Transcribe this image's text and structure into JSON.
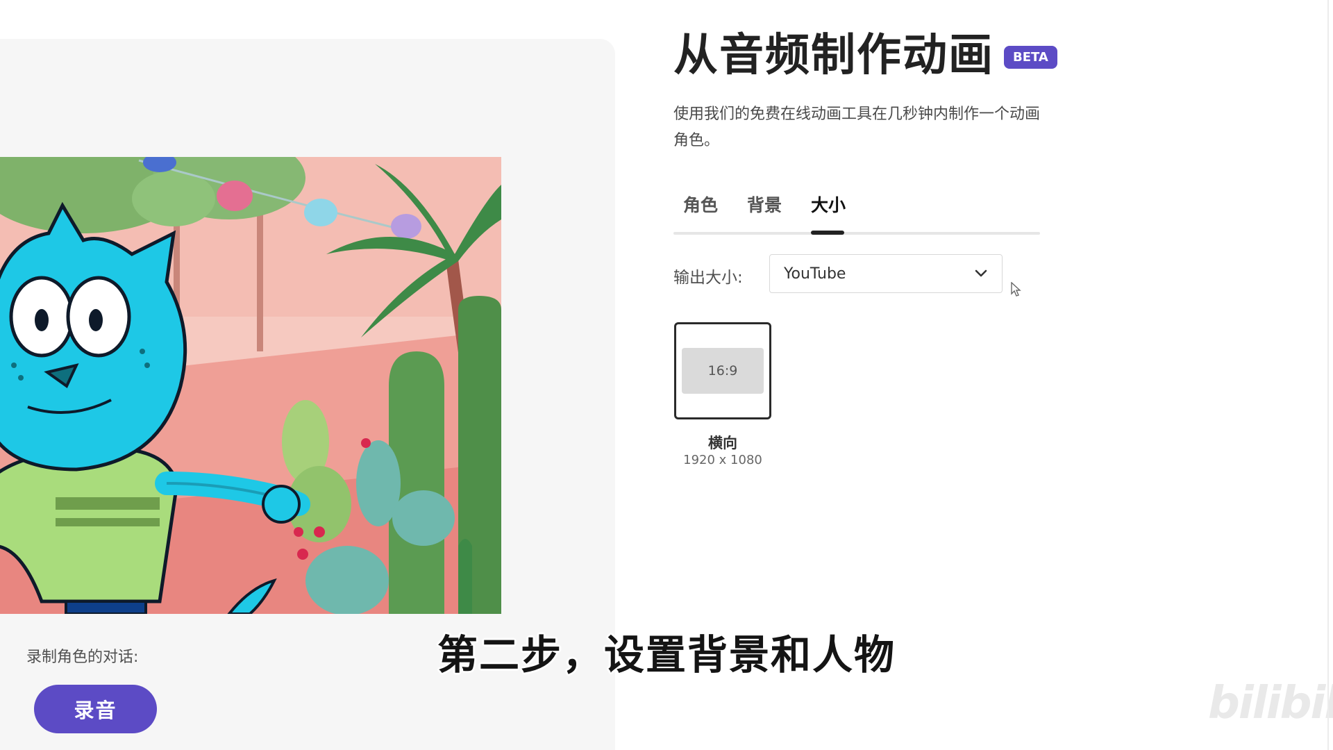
{
  "header": {
    "title": "从音频制作动画",
    "badge": "BETA",
    "description": "使用我们的免费在线动画工具在几秒钟内制作一个动画角色。"
  },
  "tabs": [
    {
      "label": "角色",
      "active": false
    },
    {
      "label": "背景",
      "active": false
    },
    {
      "label": "大小",
      "active": true
    }
  ],
  "output_size": {
    "label": "输出大小:",
    "selected": "YouTube"
  },
  "aspect_option": {
    "ratio": "16:9",
    "name": "横向",
    "dimensions": "1920 x 1080"
  },
  "recording": {
    "label": "录制角色的对话:",
    "button": "录音"
  },
  "subtitle": "第二步，设置背景和人物",
  "watermark": "bilibili",
  "colors": {
    "accent": "#5c4bc5",
    "panel_bg": "#f6f6f6",
    "character": "#1ec8e6",
    "shirt": "#a9dc7c",
    "scene_bg": "#f2b4ac"
  }
}
